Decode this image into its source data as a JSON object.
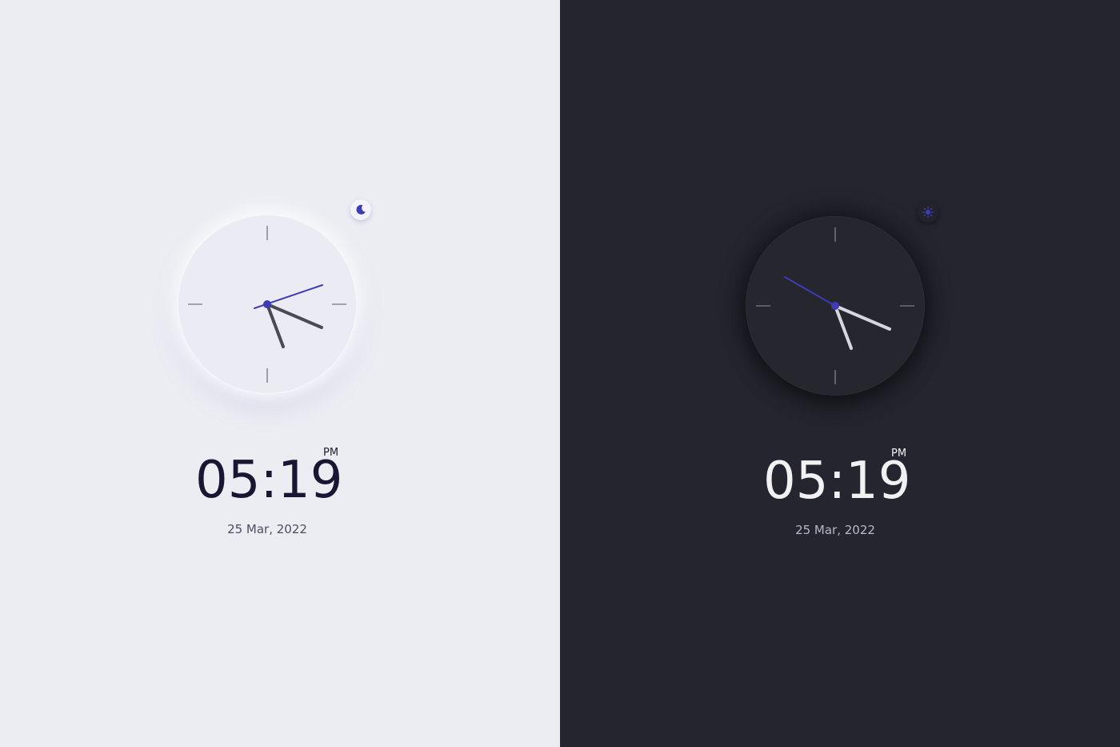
{
  "light_panel": {
    "theme": "light",
    "toggle_icon": "moon-icon",
    "time": "05:19",
    "ampm": "PM",
    "date": "25 Mar, 2022",
    "colors": {
      "background": "#ecedf3",
      "accent": "#3f3bb4",
      "hands": "#4a4a52",
      "markers": "#8a8a93"
    }
  },
  "dark_panel": {
    "theme": "dark",
    "toggle_icon": "sun-icon",
    "time": "05:19",
    "ampm": "PM",
    "date": "25 Mar, 2022",
    "colors": {
      "background": "#25252f",
      "accent": "#3f3bb4",
      "hands": "#d6d6dd",
      "markers": "#6e6e78"
    }
  }
}
